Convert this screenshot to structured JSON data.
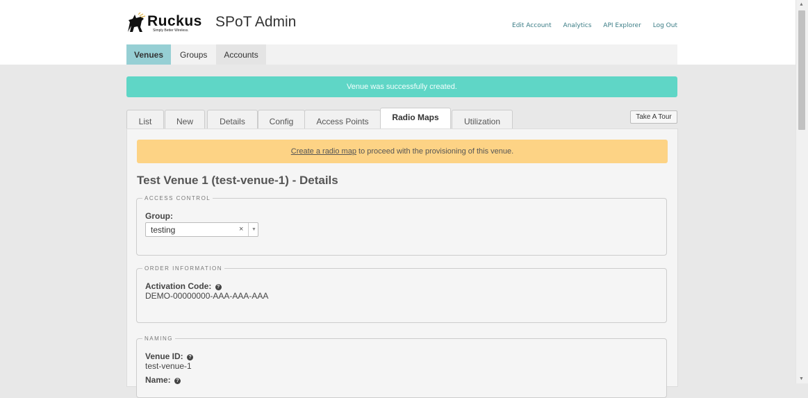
{
  "brand": {
    "name": "Ruckus",
    "tagline": "Simply Better Wireless.",
    "app_title": "SPoT Admin"
  },
  "top_nav": [
    "Edit Account",
    "Analytics",
    "API Explorer",
    "Log Out"
  ],
  "main_nav": {
    "venues": "Venues",
    "groups": "Groups",
    "accounts": "Accounts",
    "active": "Venues"
  },
  "alert": {
    "text": "Venue was successfully created."
  },
  "tabs": {
    "list": "List",
    "new": "New",
    "details": "Details",
    "config": "Config",
    "access_points": "Access Points",
    "radio_maps": "Radio Maps",
    "utilization": "Utilization",
    "active": "Radio Maps"
  },
  "tour_button": "Take A Tour",
  "warning": {
    "link": "Create a radio map",
    "text": " to proceed with the provisioning of this venue."
  },
  "page_title": "Test Venue 1 (test-venue-1) - Details",
  "access_control": {
    "legend": "ACCESS CONTROL",
    "group_label": "Group:",
    "group_value": "testing",
    "clear_glyph": "×",
    "arrow_glyph": "▼"
  },
  "order_information": {
    "legend": "ORDER INFORMATION",
    "activation_label": "Activation Code:",
    "activation_value": "DEMO-00000000-AAA-AAA-AAA"
  },
  "naming": {
    "legend": "NAMING",
    "venue_id_label": "Venue ID:",
    "venue_id_value": "test-venue-1",
    "name_label": "Name:"
  },
  "icons": {
    "help": "question-circle-icon"
  },
  "colors": {
    "accent": "#96cfd4",
    "success": "#5fd6c6",
    "warning": "#fdd385",
    "link": "#3a7c85"
  }
}
